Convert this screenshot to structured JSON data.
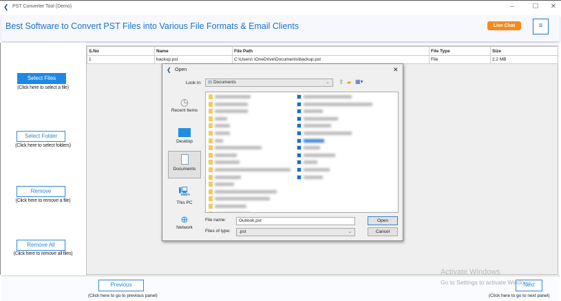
{
  "window": {
    "title": "PST Converter Tool (Demo)",
    "controls": [
      "–",
      "☐",
      "✕"
    ]
  },
  "header": {
    "title": "Best Software to Convert PST Files into Various File Formats & Email Clients",
    "live_chat": "Live Chat",
    "menu_icon": "≡"
  },
  "left_panel": [
    {
      "label": "Select Files",
      "caption": "(Click here to select a file)"
    },
    {
      "label": "Select Folder",
      "caption": "(Click here to select folders)"
    },
    {
      "label": "Remove",
      "caption": "(Click here to remove a file)"
    },
    {
      "label": "Remove All",
      "caption": "(Click here to remove all files)"
    }
  ],
  "table": {
    "columns": [
      "S.No",
      "Name",
      "File Path",
      "File Type",
      "Size"
    ],
    "rows": [
      [
        "1",
        "backup.pst",
        "C:\\Users\\        \\OneDrive\\Documents\\backup.pst",
        "File",
        "2.2 MB"
      ]
    ]
  },
  "dialog": {
    "title": "Open",
    "look_in_label": "Look in:",
    "look_in_value": "Documents",
    "places": [
      "Recent Items",
      "Desktop",
      "Documents",
      "This PC",
      "Network"
    ],
    "selected_place": "Documents",
    "file_name_label": "File name:",
    "file_name_value": "Outlook.pst",
    "file_type_label": "Files of type:",
    "file_type_value": ".pst",
    "open_label": "Open",
    "cancel_label": "Cancel",
    "close_icon": "✕"
  },
  "footer": {
    "previous_label": "Previous",
    "previous_caption": "(Click here to go to previous panel)",
    "next_label": "Next",
    "next_caption": "(Click here to go to next panel)"
  },
  "watermark": {
    "line1": "Activate Windows",
    "line2": "Go to Settings to activate Windows."
  },
  "colors": {
    "accent": "#1a73c9",
    "live_chat": "#f58a1f",
    "button_fill": "#1e88e5"
  }
}
